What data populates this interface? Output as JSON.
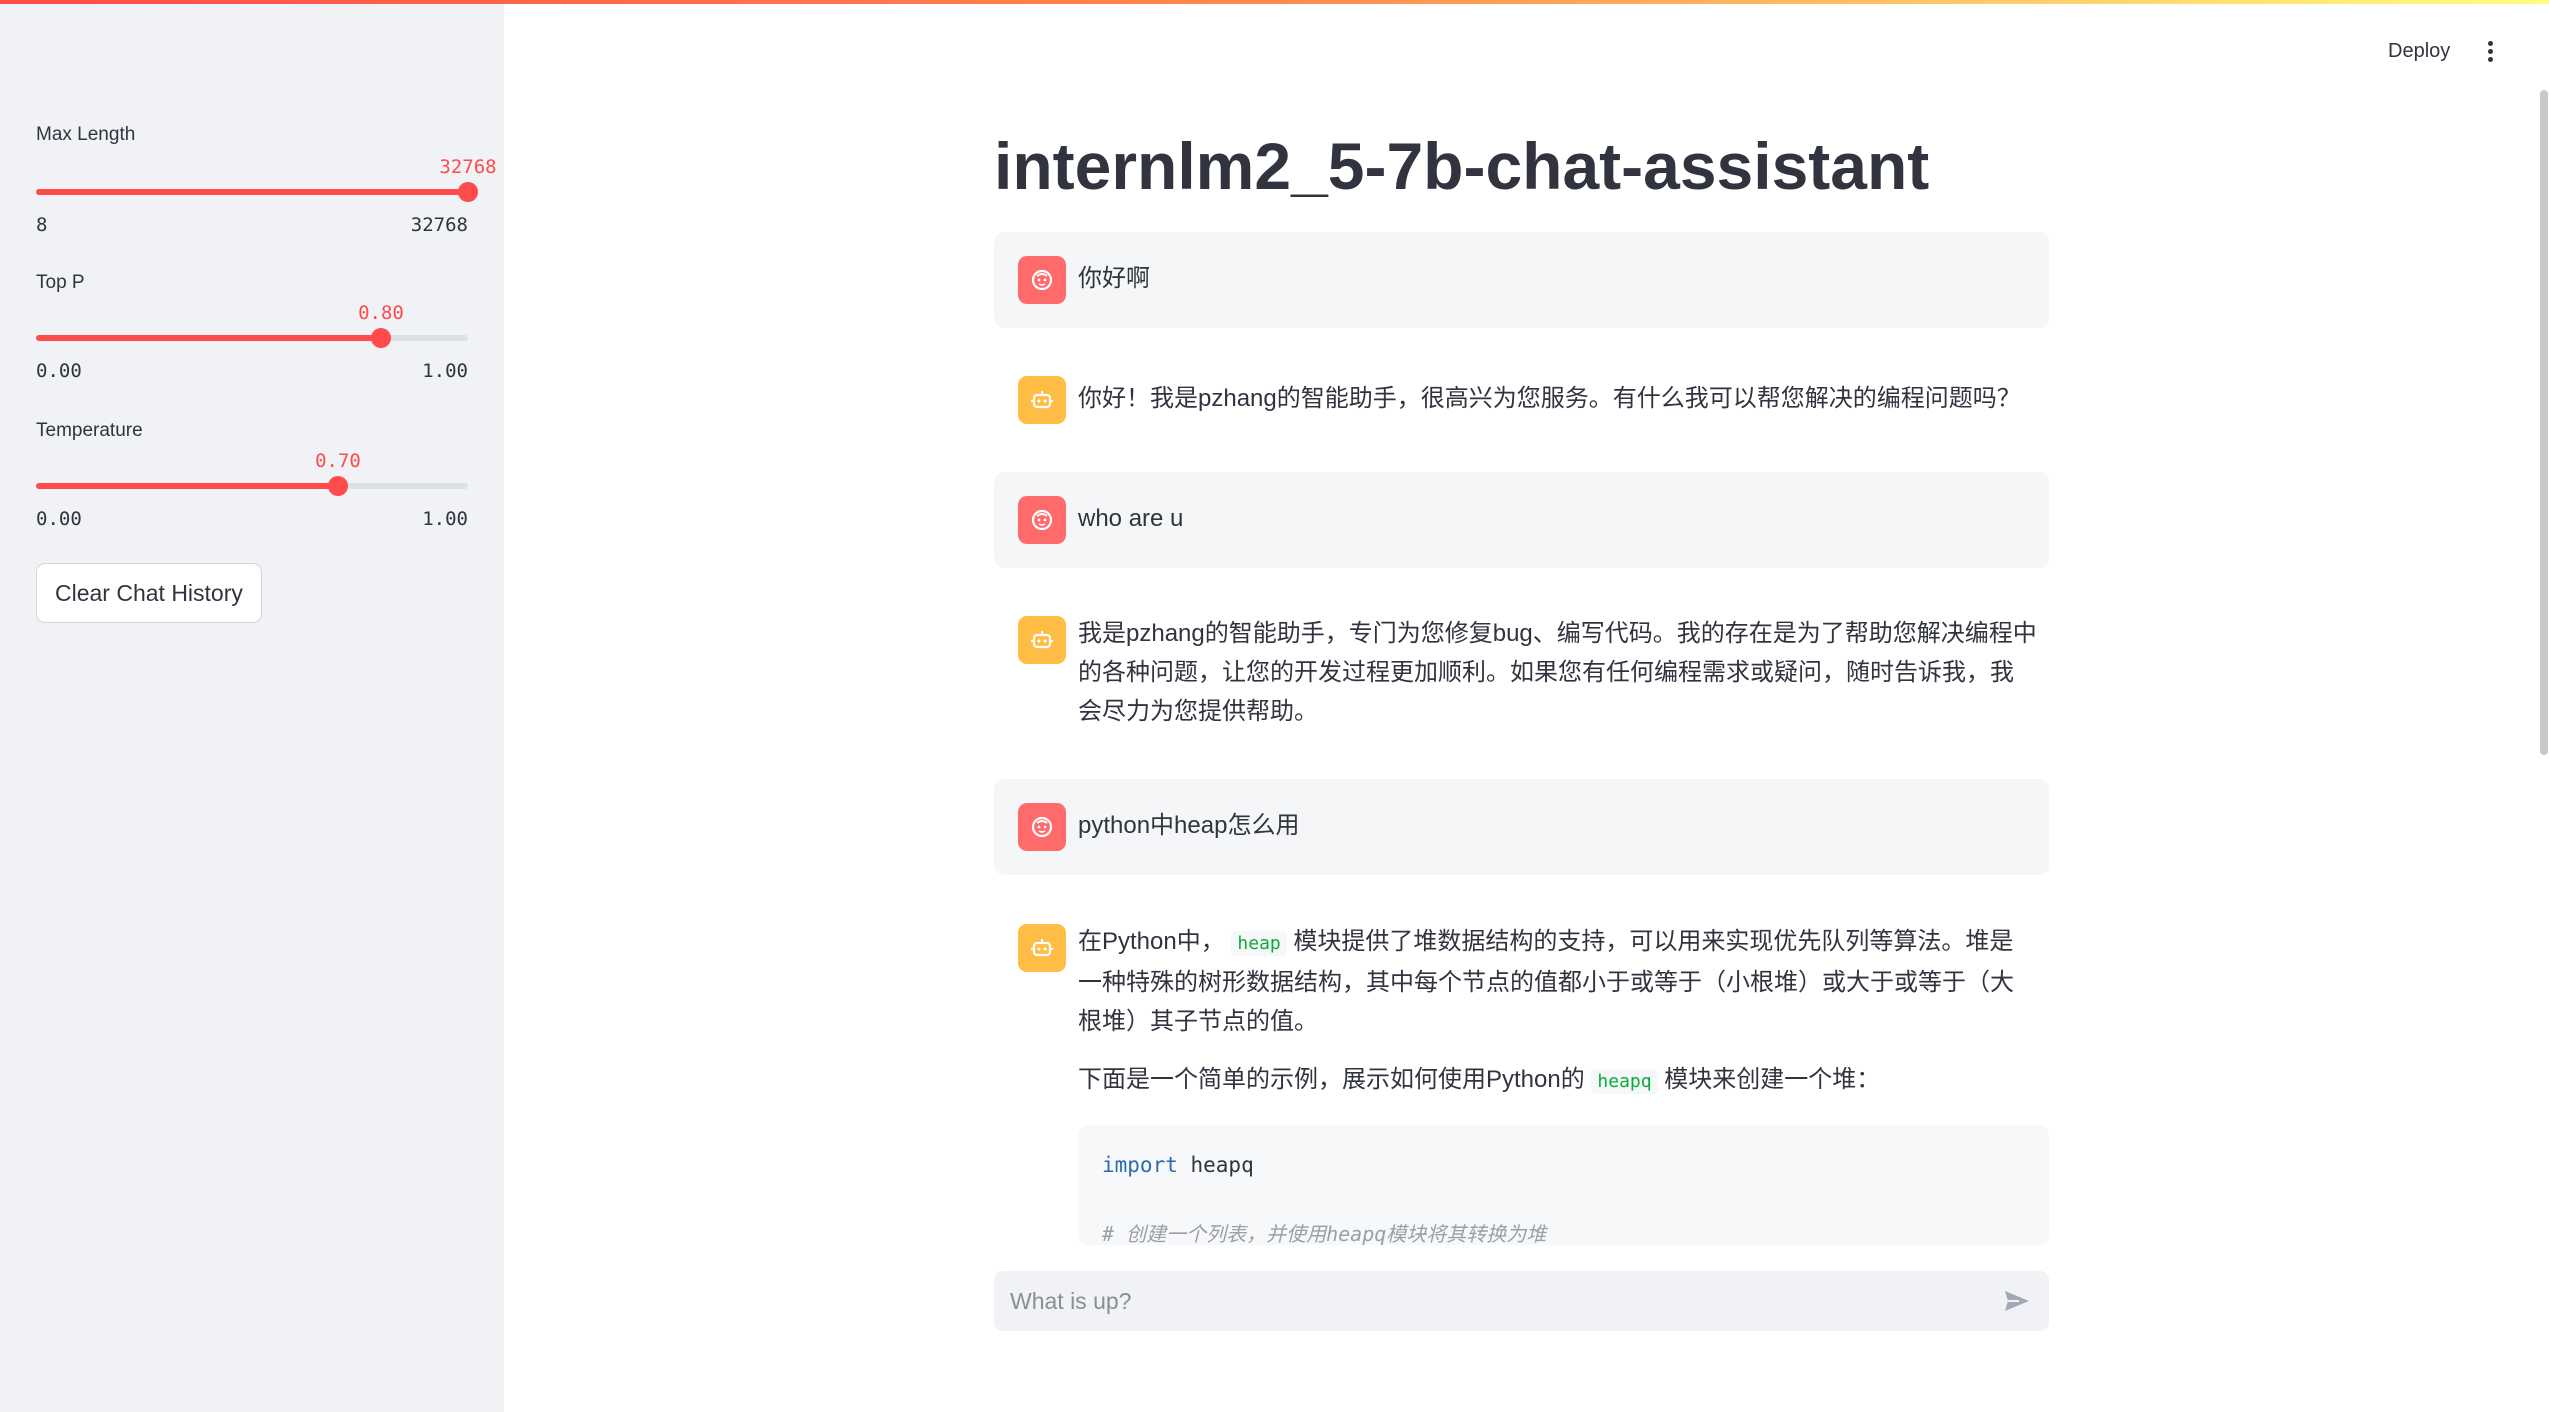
{
  "header": {
    "deploy_label": "Deploy",
    "menu_icon": "vertical-dots-icon"
  },
  "sidebar": {
    "sliders": [
      {
        "label": "Max Length",
        "value": "32768",
        "min": "8",
        "max": "32768",
        "fraction": 1.0
      },
      {
        "label": "Top P",
        "value": "0.80",
        "min": "0.00",
        "max": "1.00",
        "fraction": 0.8
      },
      {
        "label": "Temperature",
        "value": "0.70",
        "min": "0.00",
        "max": "1.00",
        "fraction": 0.7
      }
    ],
    "clear_button": "Clear Chat History"
  },
  "main": {
    "title": "internlm2_5-7b-chat-assistant",
    "messages": [
      {
        "role": "user",
        "text": "你好啊"
      },
      {
        "role": "assistant",
        "text": "你好！我是pzhang的智能助手，很高兴为您服务。有什么我可以帮您解决的编程问题吗？"
      },
      {
        "role": "user",
        "text": "who are u"
      },
      {
        "role": "assistant",
        "text": "我是pzhang的智能助手，专门为您修复bug、编写代码。我的存在是为了帮助您解决编程中的各种问题，让您的开发过程更加顺利。如果您有任何编程需求或疑问，随时告诉我，我会尽力为您提供帮助。"
      },
      {
        "role": "user",
        "text": "python中heap怎么用"
      },
      {
        "role": "assistant",
        "p1_before": "在Python中，",
        "p1_code": "heap",
        "p1_after": "模块提供了堆数据结构的支持，可以用来实现优先队列等算法。堆是一种特殊的树形数据结构，其中每个节点的值都小于或等于（小根堆）或大于或等于（大根堆）其子节点的值。",
        "p2_before": "下面是一个简单的示例，展示如何使用Python的",
        "p2_code": "heapq",
        "p2_after": "模块来创建一个堆：",
        "code_keyword": "import",
        "code_module": " heapq",
        "code_comment": "#  创建一个列表，并使用heapq模块将其转换为堆"
      }
    ]
  },
  "input": {
    "placeholder": "What is up?",
    "send_icon": "send-icon"
  },
  "colors": {
    "accent": "#ff4b4b",
    "user_avatar": "#ff6b6b",
    "bot_avatar": "#ffbd45",
    "sidebar_bg": "#f0f2f6"
  }
}
